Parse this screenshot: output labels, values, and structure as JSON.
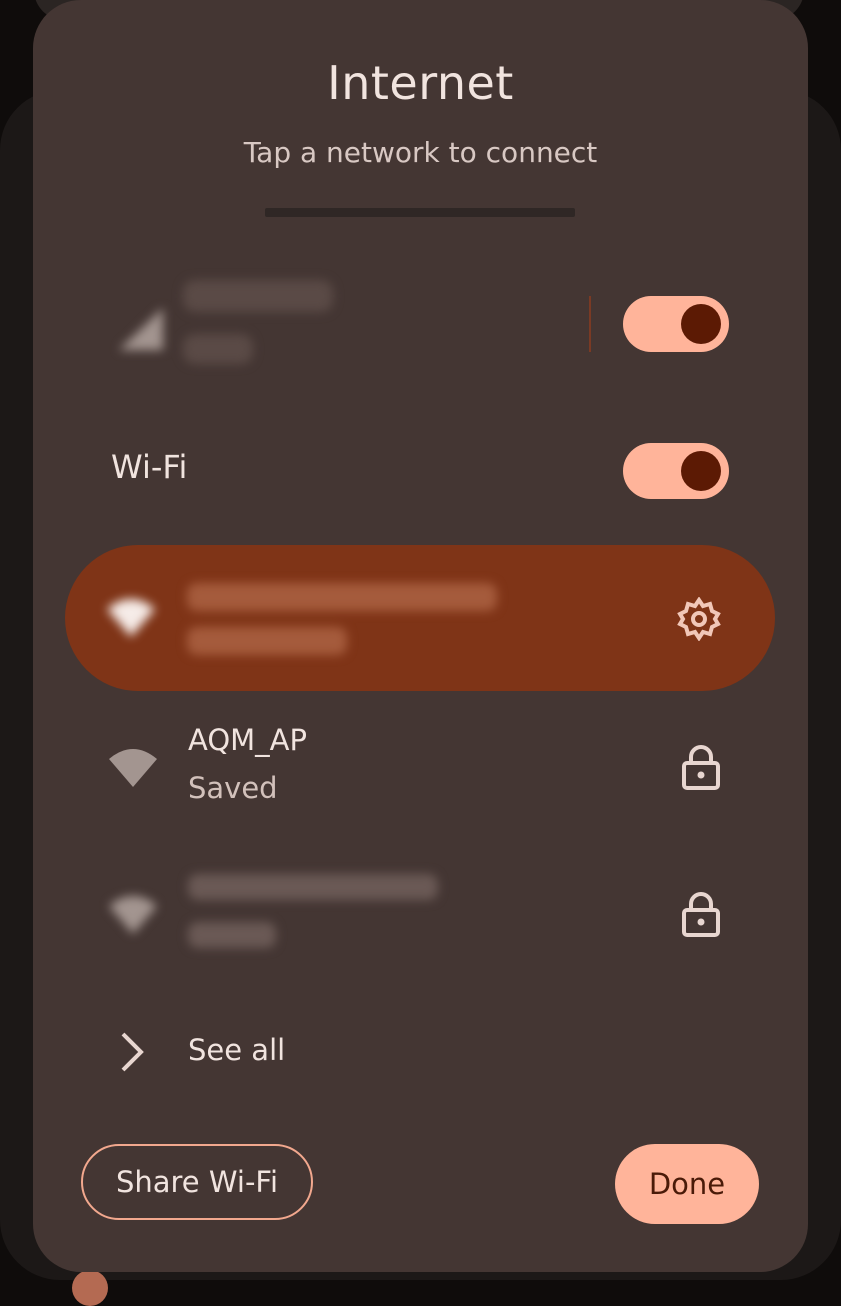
{
  "dialog": {
    "title": "Internet",
    "subtitle": "Tap a network to connect"
  },
  "mobile": {
    "carrier": "",
    "network_type": "",
    "toggle_on": true
  },
  "wifi": {
    "label": "Wi-Fi",
    "toggle_on": true
  },
  "networks": [
    {
      "name": "",
      "status": "",
      "state": "connected",
      "icon": "wifi-icon",
      "action_icon": "gear-icon"
    },
    {
      "name": "AQM_AP",
      "status": "Saved",
      "state": "saved",
      "icon": "wifi-icon",
      "action_icon": "lock-icon"
    },
    {
      "name": "",
      "status": "",
      "state": "saved",
      "icon": "wifi-icon",
      "action_icon": "lock-icon"
    }
  ],
  "see_all": {
    "label": "See all",
    "icon": "chevron-right-icon"
  },
  "buttons": {
    "share_label": "Share Wi-Fi",
    "done_label": "Done"
  },
  "colors": {
    "dialog_bg": "#443633",
    "accent": "#ffb49a",
    "connected_bg": "#7f3417",
    "toggle_knob": "#5c1a04"
  }
}
